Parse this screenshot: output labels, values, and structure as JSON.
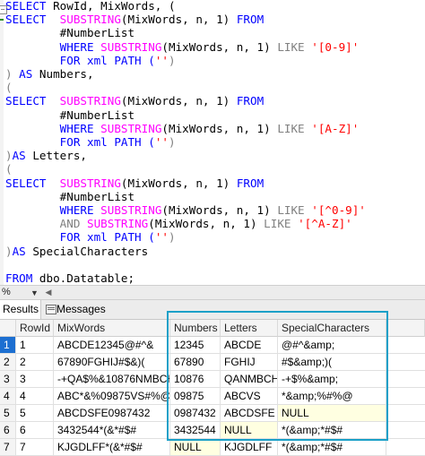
{
  "editor": {
    "lines": [
      [
        {
          "t": "SELECT ",
          "c": "kw"
        },
        {
          "t": "RowId, MixWords, (",
          "c": "plain"
        }
      ],
      [
        {
          "t": "SELECT  ",
          "c": "kw"
        },
        {
          "t": "SUBSTRING",
          "c": "fn"
        },
        {
          "t": "(MixWords, n, 1) ",
          "c": "plain"
        },
        {
          "t": "FROM",
          "c": "kw"
        }
      ],
      [
        {
          "t": "        #NumberList",
          "c": "plain"
        }
      ],
      [
        {
          "t": "        WHERE ",
          "c": "kw"
        },
        {
          "t": "SUBSTRING",
          "c": "fn"
        },
        {
          "t": "(MixWords, n, 1) ",
          "c": "plain"
        },
        {
          "t": "LIKE ",
          "c": "gray"
        },
        {
          "t": "'[0-9]'",
          "c": "str"
        }
      ],
      [
        {
          "t": "        FOR xml PATH (",
          "c": "kw"
        },
        {
          "t": "''",
          "c": "str"
        },
        {
          "t": ")",
          "c": "gray"
        }
      ],
      [
        {
          "t": ") ",
          "c": "gray"
        },
        {
          "t": "AS ",
          "c": "kw"
        },
        {
          "t": "Numbers,",
          "c": "plain"
        }
      ],
      [
        {
          "t": "(",
          "c": "gray"
        }
      ],
      [
        {
          "t": "SELECT  ",
          "c": "kw"
        },
        {
          "t": "SUBSTRING",
          "c": "fn"
        },
        {
          "t": "(MixWords, n, 1) ",
          "c": "plain"
        },
        {
          "t": "FROM",
          "c": "kw"
        }
      ],
      [
        {
          "t": "        #NumberList",
          "c": "plain"
        }
      ],
      [
        {
          "t": "        WHERE ",
          "c": "kw"
        },
        {
          "t": "SUBSTRING",
          "c": "fn"
        },
        {
          "t": "(MixWords, n, 1) ",
          "c": "plain"
        },
        {
          "t": "LIKE ",
          "c": "gray"
        },
        {
          "t": "'[A-Z]'",
          "c": "str"
        }
      ],
      [
        {
          "t": "        FOR xml PATH (",
          "c": "kw"
        },
        {
          "t": "''",
          "c": "str"
        },
        {
          "t": ")",
          "c": "gray"
        }
      ],
      [
        {
          "t": ")",
          "c": "gray"
        },
        {
          "t": "AS ",
          "c": "kw"
        },
        {
          "t": "Letters,",
          "c": "plain"
        }
      ],
      [
        {
          "t": "(",
          "c": "gray"
        }
      ],
      [
        {
          "t": "SELECT  ",
          "c": "kw"
        },
        {
          "t": "SUBSTRING",
          "c": "fn"
        },
        {
          "t": "(MixWords, n, 1) ",
          "c": "plain"
        },
        {
          "t": "FROM",
          "c": "kw"
        }
      ],
      [
        {
          "t": "        #NumberList",
          "c": "plain"
        }
      ],
      [
        {
          "t": "        WHERE ",
          "c": "kw"
        },
        {
          "t": "SUBSTRING",
          "c": "fn"
        },
        {
          "t": "(MixWords, n, 1) ",
          "c": "plain"
        },
        {
          "t": "LIKE ",
          "c": "gray"
        },
        {
          "t": "'[^0-9]'",
          "c": "str"
        }
      ],
      [
        {
          "t": "        AND ",
          "c": "gray"
        },
        {
          "t": "SUBSTRING",
          "c": "fn"
        },
        {
          "t": "(MixWords, n, 1) ",
          "c": "plain"
        },
        {
          "t": "LIKE ",
          "c": "gray"
        },
        {
          "t": "'[^A-Z]'",
          "c": "str"
        }
      ],
      [
        {
          "t": "        FOR xml PATH (",
          "c": "kw"
        },
        {
          "t": "''",
          "c": "str"
        },
        {
          "t": ")",
          "c": "gray"
        }
      ],
      [
        {
          "t": ")",
          "c": "gray"
        },
        {
          "t": "AS ",
          "c": "kw"
        },
        {
          "t": "SpecialCharacters",
          "c": "plain"
        }
      ],
      [],
      [
        {
          "t": "FROM ",
          "c": "kw"
        },
        {
          "t": "dbo.Datatable;",
          "c": "plain"
        }
      ]
    ],
    "fold_symbol": "−"
  },
  "zoom": {
    "value": "%",
    "arrow": "▼",
    "scroll_left": "◀"
  },
  "tabs": {
    "results": "Results",
    "messages": "Messages"
  },
  "grid": {
    "columns": [
      "RowId",
      "MixWords",
      "Numbers",
      "Letters",
      "SpecialCharacters"
    ],
    "rows": [
      {
        "num": "1",
        "rowid": "1",
        "mix": "ABCDE12345@#^&",
        "numbers": "12345",
        "letters": "ABCDE",
        "special": "@#^&amp;"
      },
      {
        "num": "2",
        "rowid": "2",
        "mix": "67890FGHIJ#$&)(",
        "numbers": "67890",
        "letters": "FGHIJ",
        "special": "#$&amp;)("
      },
      {
        "num": "3",
        "rowid": "3",
        "mix": "-+QA$%&10876NMBCH",
        "numbers": "10876",
        "letters": "QANMBCH",
        "special": "-+$%&amp;"
      },
      {
        "num": "4",
        "rowid": "4",
        "mix": "ABC*&%09875VS#%@",
        "numbers": "09875",
        "letters": "ABCVS",
        "special": "*&amp;%#%@"
      },
      {
        "num": "5",
        "rowid": "5",
        "mix": "ABCDSFE0987432",
        "numbers": "0987432",
        "letters": "ABCDSFE",
        "special": "NULL"
      },
      {
        "num": "6",
        "rowid": "6",
        "mix": "3432544*(&*#$#",
        "numbers": "3432544",
        "letters": "NULL",
        "special": "*(&amp;*#$#"
      },
      {
        "num": "7",
        "rowid": "7",
        "mix": "KJGDLFF*(&*#$#",
        "numbers": "NULL",
        "letters": "KJGDLFF",
        "special": "*(&amp;*#$#"
      }
    ]
  }
}
